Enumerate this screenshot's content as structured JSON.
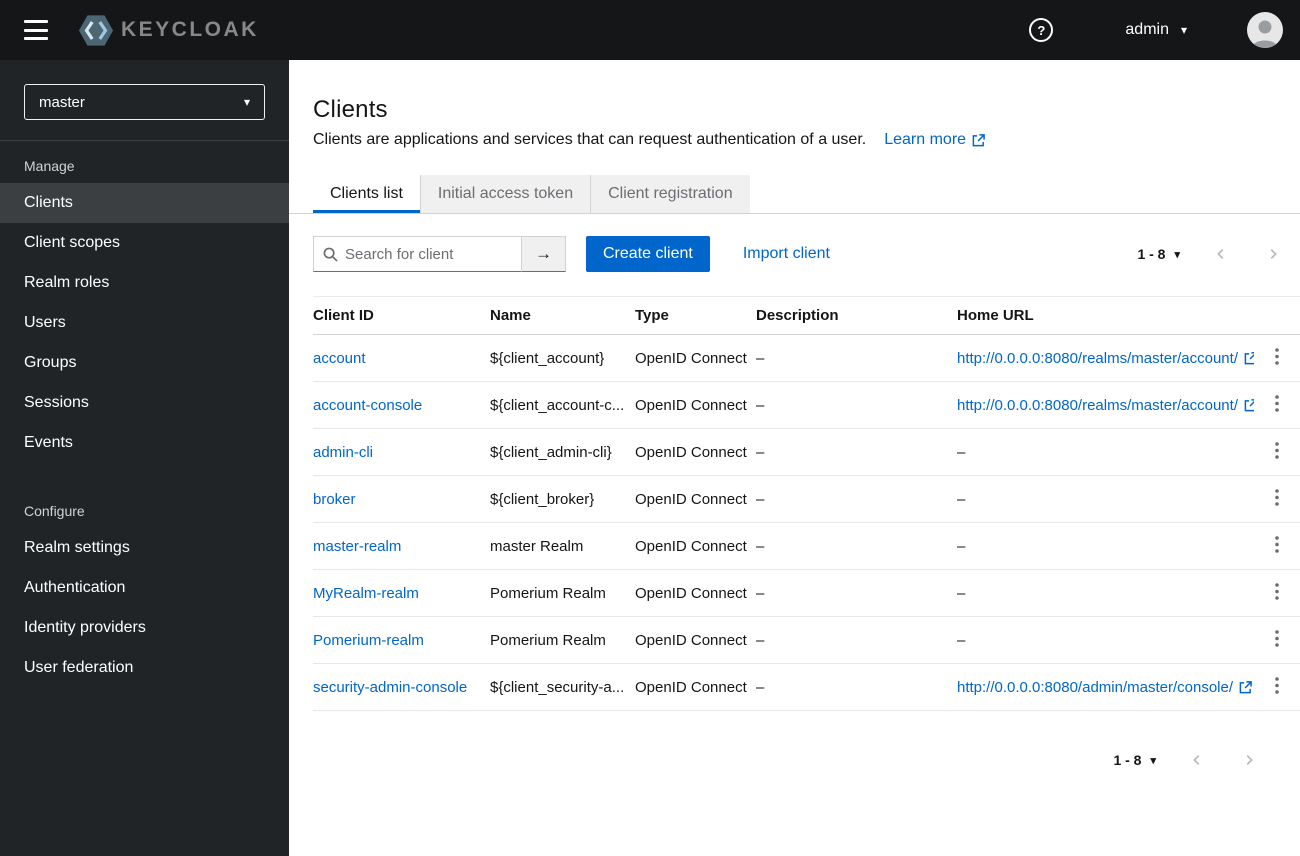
{
  "colors": {
    "accent": "#0066cc",
    "masthead_bg": "#141618",
    "sidebar_bg": "#212427"
  },
  "masthead": {
    "brand": "KEYCLOAK",
    "help_icon_label": "?",
    "user_label": "admin"
  },
  "sidebar": {
    "realm_selector": "master",
    "sections": [
      {
        "label": "Manage",
        "items": [
          {
            "label": "Clients",
            "active": true
          },
          {
            "label": "Client scopes",
            "active": false
          },
          {
            "label": "Realm roles",
            "active": false
          },
          {
            "label": "Users",
            "active": false
          },
          {
            "label": "Groups",
            "active": false
          },
          {
            "label": "Sessions",
            "active": false
          },
          {
            "label": "Events",
            "active": false
          }
        ]
      },
      {
        "label": "Configure",
        "items": [
          {
            "label": "Realm settings",
            "active": false
          },
          {
            "label": "Authentication",
            "active": false
          },
          {
            "label": "Identity providers",
            "active": false
          },
          {
            "label": "User federation",
            "active": false
          }
        ]
      }
    ]
  },
  "page": {
    "title": "Clients",
    "subtitle": "Clients are applications and services that can request authentication of a user.",
    "learn_more_label": "Learn more"
  },
  "tabs": [
    {
      "label": "Clients list",
      "active": true
    },
    {
      "label": "Initial access token",
      "active": false
    },
    {
      "label": "Client registration",
      "active": false
    }
  ],
  "toolbar": {
    "search_placeholder": "Search for client",
    "search_value": "",
    "create_button_label": "Create client",
    "import_link_label": "Import client",
    "pagination_range": "1 - 8"
  },
  "table": {
    "columns": [
      "Client ID",
      "Name",
      "Type",
      "Description",
      "Home URL"
    ],
    "rows": [
      {
        "client_id": "account",
        "name": "${client_account}",
        "type": "OpenID Connect",
        "description": "–",
        "home_url": "http://0.0.0.0:8080/realms/master/account/"
      },
      {
        "client_id": "account-console",
        "name": "${client_account-c...",
        "type": "OpenID Connect",
        "description": "–",
        "home_url": "http://0.0.0.0:8080/realms/master/account/"
      },
      {
        "client_id": "admin-cli",
        "name": "${client_admin-cli}",
        "type": "OpenID Connect",
        "description": "–",
        "home_url": "–"
      },
      {
        "client_id": "broker",
        "name": "${client_broker}",
        "type": "OpenID Connect",
        "description": "–",
        "home_url": "–"
      },
      {
        "client_id": "master-realm",
        "name": "master Realm",
        "type": "OpenID Connect",
        "description": "–",
        "home_url": "–"
      },
      {
        "client_id": "MyRealm-realm",
        "name": "Pomerium Realm",
        "type": "OpenID Connect",
        "description": "–",
        "home_url": "–"
      },
      {
        "client_id": "Pomerium-realm",
        "name": "Pomerium Realm",
        "type": "OpenID Connect",
        "description": "–",
        "home_url": "–"
      },
      {
        "client_id": "security-admin-console",
        "name": "${client_security-a...",
        "type": "OpenID Connect",
        "description": "–",
        "home_url": "http://0.0.0.0:8080/admin/master/console/"
      }
    ]
  },
  "footer_pagination": {
    "range": "1 - 8"
  }
}
